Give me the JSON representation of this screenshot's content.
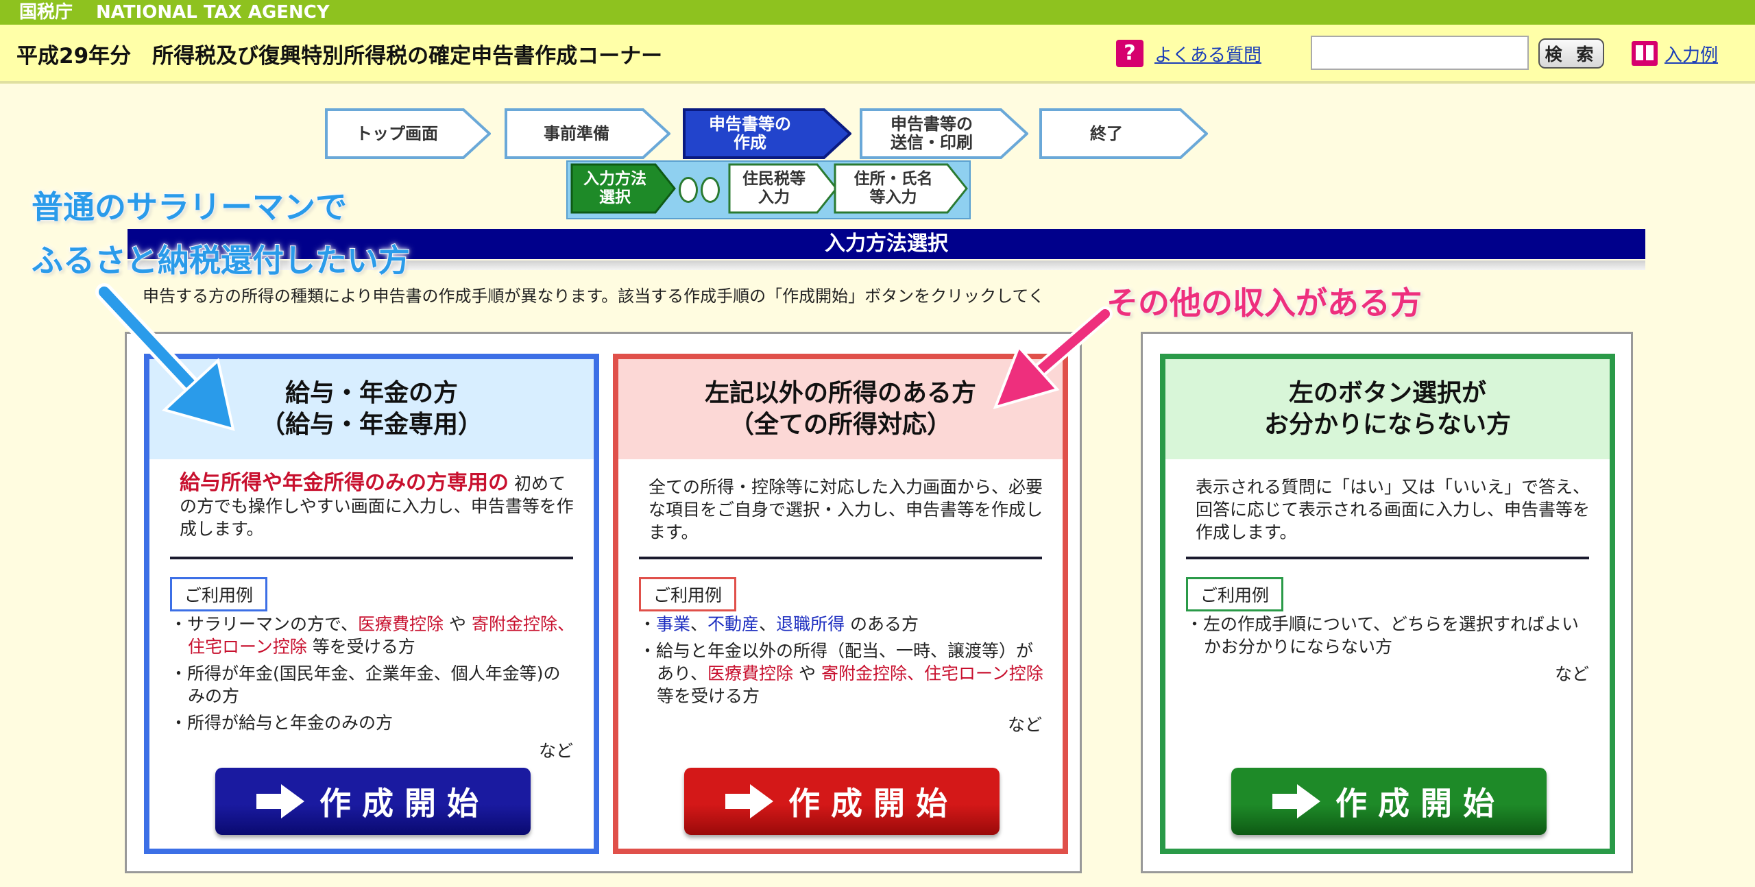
{
  "header": {
    "agency_jp": "国税庁",
    "agency_en": "NATIONAL TAX AGENCY",
    "page_title": "平成29年分　所得税及び復興特別所得税の確定申告書作成コーナー",
    "help_icon_glyph": "?",
    "faq_label": "よくある質問",
    "search_value": "",
    "search_button": "検 索",
    "input_example_label": "入力例"
  },
  "steps": [
    {
      "label": "トップ画面",
      "state": "done"
    },
    {
      "label": "事前準備",
      "state": "done"
    },
    {
      "label": "申告書等の\n作成",
      "state": "active"
    },
    {
      "label": "申告書等の\n送信・印刷",
      "state": "todo"
    },
    {
      "label": "終了",
      "state": "todo"
    }
  ],
  "substeps": [
    {
      "label": "入力方法\n選択",
      "state": "active"
    },
    {
      "label": "住民税等\n入力",
      "state": "todo"
    },
    {
      "label": "住所・氏名\n等入力",
      "state": "todo"
    }
  ],
  "section": {
    "title": "入力方法選択",
    "instruction": "申告する方の所得の種類により申告書の作成手順が異なります。該当する作成手順の「作成開始」ボタンをクリックしてく"
  },
  "annotations": {
    "blue_line1": "普通のサラリーマンで",
    "blue_line2": "ふるさと納税還付したい方",
    "pink": "その他の収入がある方"
  },
  "cards": [
    {
      "head_line1": "給与・年金の方",
      "head_line2": "（給与・年金専用）",
      "desc_highlight": "給与所得や年金所得のみの方専用の",
      "desc_text": "初めての方でも操作しやすい画面に入力し、申告書等を作成します。",
      "usage_label": "ご利用例",
      "usage": [
        {
          "parts": [
            {
              "t": "・サラリーマンの方で、",
              "c": ""
            },
            {
              "t": "医療費控除",
              "c": "red"
            },
            {
              "t": " や ",
              "c": ""
            },
            {
              "t": "寄附金控除、住宅ローン控除",
              "c": "red"
            },
            {
              "t": " 等を受ける方",
              "c": ""
            }
          ]
        },
        {
          "parts": [
            {
              "t": "・所得が年金(国民年金、企業年金、個人年金等)のみの方",
              "c": ""
            }
          ]
        },
        {
          "parts": [
            {
              "t": "・所得が給与と年金のみの方",
              "c": ""
            }
          ]
        }
      ],
      "etc": "など",
      "button": "作成開始",
      "colors": {
        "border": "#3c6fe6",
        "head_bg": "#d8eeff",
        "btn": "#1a1aa0",
        "btn_dark": "#0a0a70"
      }
    },
    {
      "head_line1": "左記以外の所得のある方",
      "head_line2": "（全ての所得対応）",
      "desc_highlight": "",
      "desc_text": "全ての所得・控除等に対応した入力画面から、必要な項目をご自身で選択・入力し、申告書等を作成します。",
      "usage_label": "ご利用例",
      "usage": [
        {
          "parts": [
            {
              "t": "・",
              "c": ""
            },
            {
              "t": "事業",
              "c": "blue"
            },
            {
              "t": "、",
              "c": ""
            },
            {
              "t": "不動産",
              "c": "blue"
            },
            {
              "t": "、",
              "c": ""
            },
            {
              "t": "退職所得",
              "c": "blue"
            },
            {
              "t": " のある方",
              "c": ""
            }
          ]
        },
        {
          "parts": [
            {
              "t": "・給与と年金以外の所得（配当、一時、譲渡等）があり、",
              "c": ""
            },
            {
              "t": "医療費控除",
              "c": "red"
            },
            {
              "t": " や ",
              "c": ""
            },
            {
              "t": "寄附金控除、住宅ローン控除",
              "c": "red"
            },
            {
              "t": " 等を受ける方",
              "c": ""
            }
          ]
        }
      ],
      "etc": "など",
      "button": "作成開始",
      "colors": {
        "border": "#e0504a",
        "head_bg": "#fcd8d6",
        "btn": "#d41818",
        "btn_dark": "#9a0a0a"
      }
    },
    {
      "head_line1": "左のボタン選択が",
      "head_line2": "お分かりにならない方",
      "desc_highlight": "",
      "desc_text": "表示される質問に「はい」又は「いいえ」で答え、回答に応じて表示される画面に入力し、申告書等を作成します。",
      "usage_label": "ご利用例",
      "usage": [
        {
          "parts": [
            {
              "t": "・左の作成手順について、どちらを選択すればよいかお分かりにならない方",
              "c": ""
            }
          ]
        }
      ],
      "etc": "など",
      "button": "作成開始",
      "colors": {
        "border": "#2a9a48",
        "head_bg": "#d8f6d8",
        "btn": "#1e8a28",
        "btn_dark": "#0e5a14"
      }
    }
  ]
}
